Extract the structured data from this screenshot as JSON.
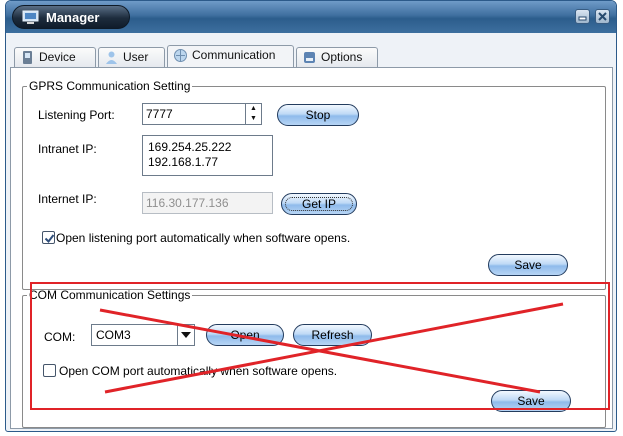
{
  "window": {
    "title": "Manager"
  },
  "tabs": [
    {
      "label": "Device",
      "active": false
    },
    {
      "label": "User",
      "active": false
    },
    {
      "label": "Communication",
      "active": true
    },
    {
      "label": "Options",
      "active": false
    }
  ],
  "gprs": {
    "title": "GPRS Communication Setting",
    "listening_port_label": "Listening Port:",
    "listening_port_value": "7777",
    "stop_button": "Stop",
    "intranet_ip_label": "Intranet IP:",
    "intranet_ips": [
      "169.254.25.222",
      "192.168.1.77"
    ],
    "internet_ip_label": "Internet IP:",
    "internet_ip_value": "116.30.177.136",
    "get_ip_button": "Get IP",
    "auto_open_label": "Open listening port automatically when software opens.",
    "auto_open_checked": true,
    "save_button": "Save"
  },
  "com": {
    "title": "COM Communication Settings",
    "com_label": "COM:",
    "com_value": "COM3",
    "open_button": "Open",
    "refresh_button": "Refresh",
    "auto_open_label": "Open COM port automatically when software opens.",
    "auto_open_checked": false,
    "save_button": "Save"
  },
  "annotation": {
    "color": "#e02328"
  }
}
